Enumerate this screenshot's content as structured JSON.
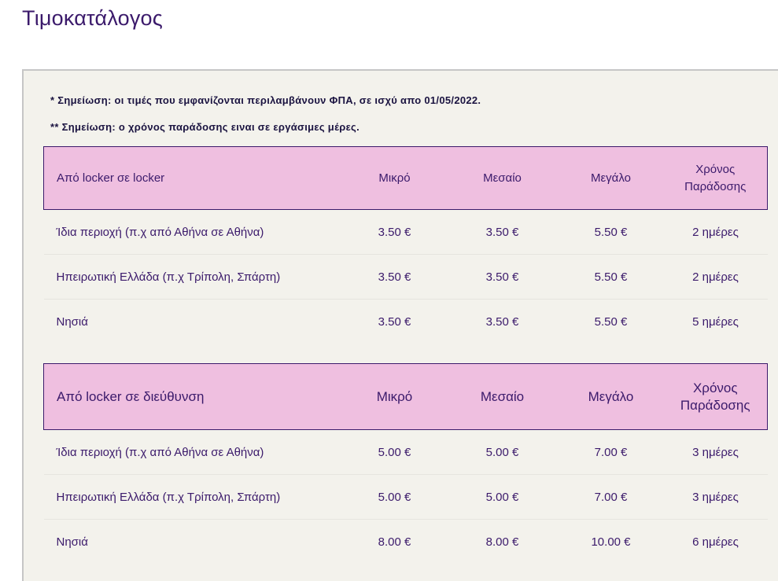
{
  "page": {
    "title": "Τιμοκατάλογος"
  },
  "notes": {
    "vat": "* Σημείωση: οι τιμές που εμφανίζονται περιλαμβάνουν ΦΠΑ, σε ισχύ απο 01/05/2022.",
    "delivery": "** Σημείωση: ο χρόνος παράδοσης ειναι σε εργάσιμες μέρες."
  },
  "tables": [
    {
      "headers": [
        "Από locker σε locker",
        "Μικρό",
        "Μεσαίο",
        "Μεγάλο",
        "Χρόνος Παράδοσης"
      ],
      "rows": [
        [
          "Ίδια περιοχή (π.χ από Αθήνα σε Αθήνα)",
          "3.50 €",
          "3.50 €",
          "5.50 €",
          "2 ημέρες"
        ],
        [
          "Ηπειρωτική Ελλάδα (π.χ Τρίπολη, Σπάρτη)",
          "3.50 €",
          "3.50 €",
          "5.50 €",
          "2 ημέρες"
        ],
        [
          "Νησιά",
          "3.50 €",
          "3.50 €",
          "5.50 €",
          "5 ημέρες"
        ]
      ]
    },
    {
      "headers": [
        "Από locker σε διεύθυνση",
        "Μικρό",
        "Μεσαίο",
        "Μεγάλο",
        "Χρόνος Παράδοσης"
      ],
      "rows": [
        [
          "Ίδια περιοχή (π.χ από Αθήνα σε Αθήνα)",
          "5.00 €",
          "5.00 €",
          "7.00 €",
          "3 ημέρες"
        ],
        [
          "Ηπειρωτική Ελλάδα (π.χ Τρίπολη, Σπάρτη)",
          "5.00 €",
          "5.00 €",
          "7.00 €",
          "3 ημέρες"
        ],
        [
          "Νησιά",
          "8.00 €",
          "8.00 €",
          "10.00 €",
          "6 ημέρες"
        ]
      ]
    }
  ]
}
